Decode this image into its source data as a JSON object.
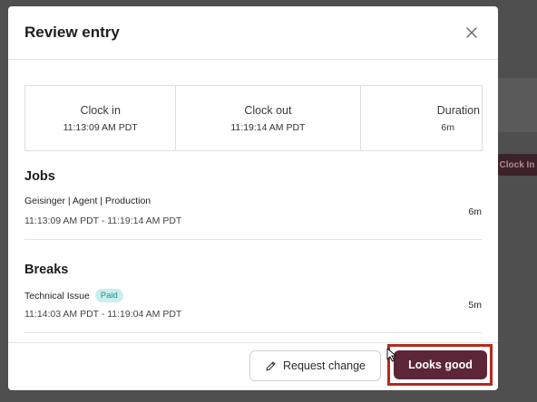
{
  "background": {
    "clock_in_button": "Clock In"
  },
  "modal": {
    "title": "Review entry",
    "summary": {
      "clock_in": {
        "label": "Clock in",
        "value": "11:13:09 AM PDT"
      },
      "clock_out": {
        "label": "Clock out",
        "value": "11:19:14 AM PDT"
      },
      "duration": {
        "label": "Duration",
        "value": "6m"
      }
    },
    "jobs": {
      "title": "Jobs",
      "items": [
        {
          "name": "Geisinger | Agent | Production",
          "time": "11:13:09 AM PDT - 11:19:14 AM PDT",
          "duration": "6m"
        }
      ]
    },
    "breaks": {
      "title": "Breaks",
      "items": [
        {
          "name": "Technical Issue",
          "badge": "Paid",
          "time": "11:14:03 AM PDT - 11:19:04 AM PDT",
          "duration": "5m"
        }
      ]
    },
    "footer": {
      "request_change_label": "Request change",
      "looks_good_label": "Looks good"
    }
  },
  "colors": {
    "primary_button": "#5c2638",
    "paid_badge_bg": "#c9efee",
    "paid_badge_text": "#2b8f8e",
    "highlight_box": "#b42a1e"
  },
  "icons": [
    "close-icon",
    "pencil-icon",
    "cursor-icon"
  ]
}
